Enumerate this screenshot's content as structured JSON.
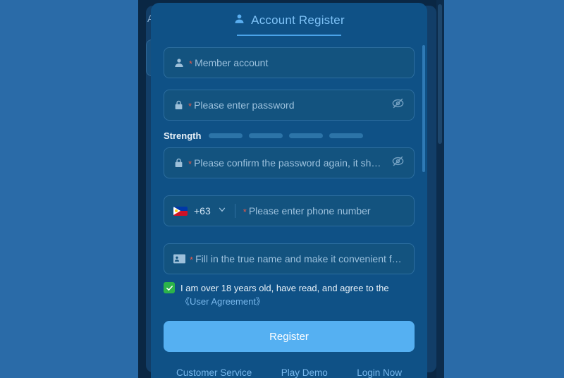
{
  "background": {
    "behind_text": "A",
    "page_color": "#2a6ba8",
    "dim_color": "#0a2744"
  },
  "modal": {
    "title": "Account Register",
    "title_icon": "user-icon",
    "accent_color": "#4aa3e8",
    "surface_color": "#0f5186"
  },
  "fields": {
    "account": {
      "icon": "user-icon",
      "required_mark": "*",
      "placeholder": "Member account",
      "value": ""
    },
    "password": {
      "icon": "lock-icon",
      "required_mark": "*",
      "placeholder": "Please enter password",
      "value": "",
      "toggle_icon": "eye-off-icon"
    },
    "confirm_password": {
      "icon": "lock-icon",
      "required_mark": "*",
      "placeholder": "Please confirm the password again, it should be t...",
      "value": "",
      "toggle_icon": "eye-off-icon"
    },
    "phone": {
      "flag": "philippines-flag-icon",
      "country_code": "+63",
      "dropdown_icon": "chevron-down-icon",
      "required_mark": "*",
      "placeholder": "Please enter phone number",
      "value": ""
    },
    "real_name": {
      "icon": "id-card-icon",
      "required_mark": "*",
      "placeholder": "Fill in the true name and make it convenient for la...",
      "value": ""
    }
  },
  "strength": {
    "label": "Strength",
    "segments": 4,
    "active": 0,
    "inactive_color": "#2c74a8",
    "active_color": "#4aa3e8"
  },
  "agreement": {
    "checked": true,
    "check_color": "#2cb34a",
    "text": "I am over 18 years old, have read, and agree to the",
    "link_text": "《User Agreement》"
  },
  "actions": {
    "register_label": "Register",
    "register_color": "#55b0f2"
  },
  "footer": {
    "links": [
      {
        "label": "Customer Service"
      },
      {
        "label": "Play Demo"
      },
      {
        "label": "Login Now"
      }
    ]
  }
}
